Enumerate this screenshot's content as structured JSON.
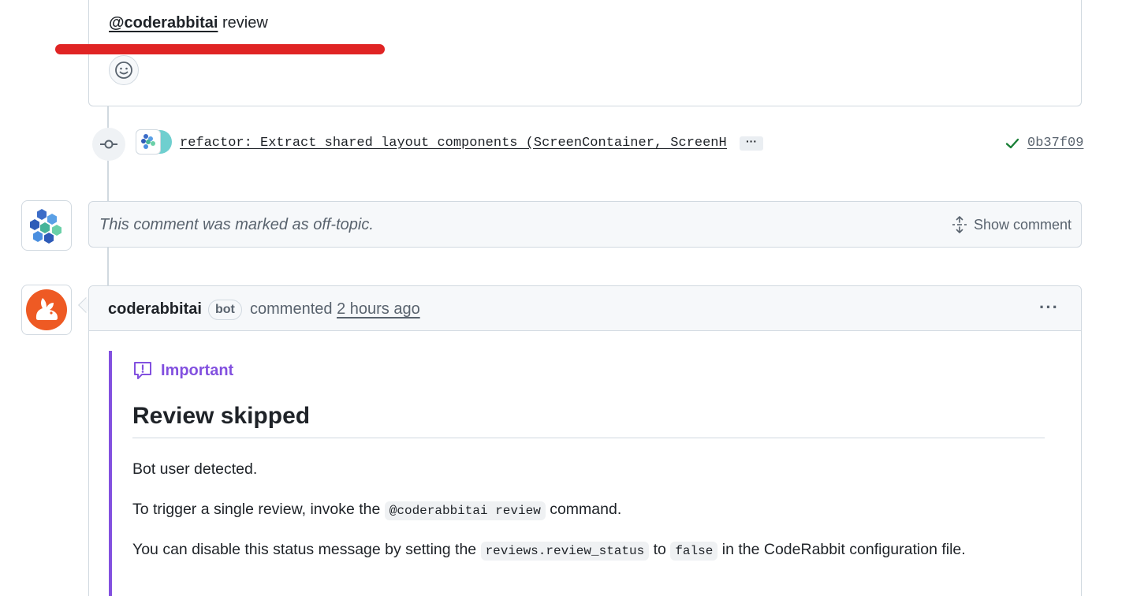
{
  "top_comment": {
    "mention": "@coderabbitai",
    "text": " review"
  },
  "commit": {
    "message": "refactor: Extract shared layout components (ScreenContainer, ScreenHe…",
    "ellipsis": "···",
    "sha": "0b37f09",
    "status": "success"
  },
  "hidden_comment": {
    "text": "This comment was marked as off-topic.",
    "show_label": "Show comment"
  },
  "main_comment": {
    "author": "coderabbitai",
    "badge": "bot",
    "action": "commented ",
    "time": "2 hours ago",
    "menu": "···",
    "alert": {
      "type_label": "Important",
      "heading": "Review skipped",
      "p1": "Bot user detected.",
      "p2_before": "To trigger a single review, invoke the ",
      "p2_code": "@coderabbitai review",
      "p2_after": " command.",
      "p3_before": "You can disable this status message by setting the ",
      "p3_code1": "reviews.review_status",
      "p3_mid": " to ",
      "p3_code2": "false",
      "p3_after": " in the CodeRabbit configuration file."
    }
  },
  "colors": {
    "accent_purple": "#8250df",
    "success_green": "#1a7f37",
    "annotation_red": "#e02424",
    "rabbit_orange": "#ee5a24"
  }
}
